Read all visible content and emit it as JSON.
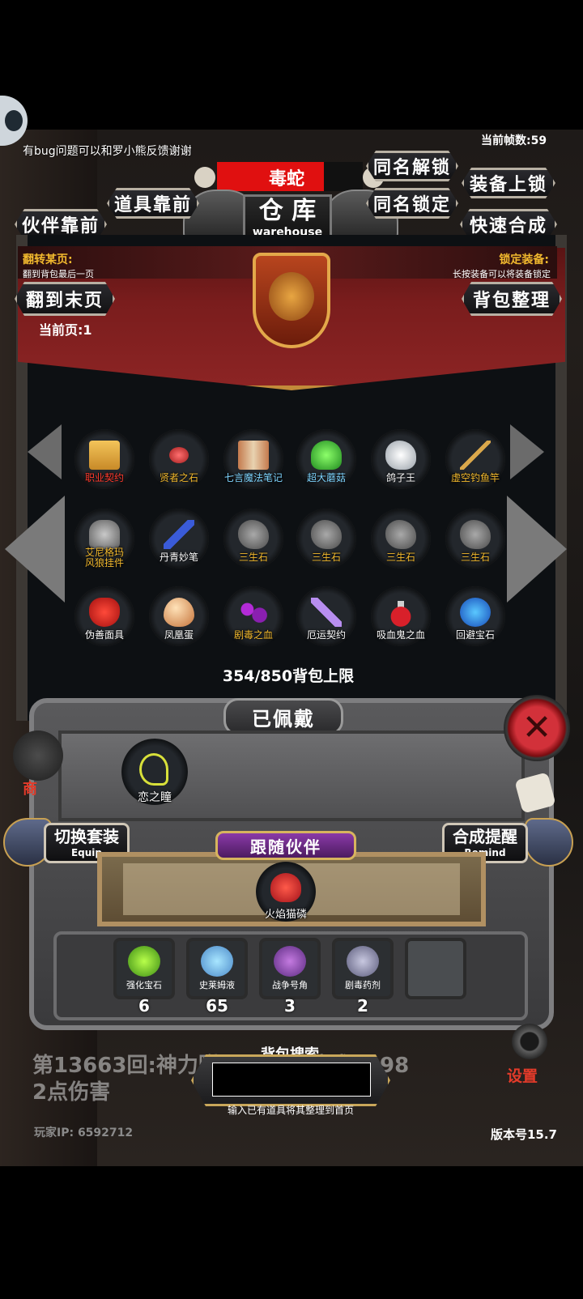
{
  "hud": {
    "feedback_text": "有bug问题可以和罗小熊反馈谢谢",
    "fps_text": "当前帧数:59",
    "companion_name": "毒蛇",
    "title_cn": "仓 库",
    "title_en": "warehouse"
  },
  "buttons": {
    "unlock_same_name": "同名解锁",
    "lock_equipment": "装备上锁",
    "items_first": "道具靠前",
    "lock_same_name": "同名锁定",
    "partner_first": "伙伴靠前",
    "quick_synthesis": "快速合成",
    "flip_to_last": "翻到末页",
    "sort_bag": "背包整理"
  },
  "info": {
    "flip_page_title": "翻转某页:",
    "flip_page_desc": "翻到背包最后一页",
    "lock_equip_title": "锁定装备:",
    "lock_equip_desc": "长按装备可以将装备锁定",
    "current_page": "当前页:1"
  },
  "inventory": {
    "items": [
      {
        "name": "职业契约",
        "color": "red",
        "icon": "scroll-icon"
      },
      {
        "name": "贤者之石",
        "color": "yellow",
        "icon": "red-stone-icon"
      },
      {
        "name": "七言魔法笔记",
        "color": "cyan",
        "icon": "book-icon"
      },
      {
        "name": "超大蘑菇",
        "color": "cyan",
        "icon": "green-mushroom-icon"
      },
      {
        "name": "鸽子王",
        "color": "white",
        "icon": "dove-icon"
      },
      {
        "name": "虚空钓鱼竿",
        "color": "yellow",
        "icon": "fishing-rod-icon"
      },
      {
        "name": "艾尼格玛\n风狼挂件",
        "color": "yellow",
        "icon": "wolf-pendant-icon"
      },
      {
        "name": "丹青妙笔",
        "color": "white",
        "icon": "brush-icon"
      },
      {
        "name": "三生石",
        "color": "yellow",
        "icon": "stone-icon"
      },
      {
        "name": "三生石",
        "color": "yellow",
        "icon": "stone-icon"
      },
      {
        "name": "三生石",
        "color": "yellow",
        "icon": "stone-icon"
      },
      {
        "name": "三生石",
        "color": "yellow",
        "icon": "stone-icon"
      },
      {
        "name": "伪善面具",
        "color": "white",
        "icon": "mask-icon"
      },
      {
        "name": "凤凰蛋",
        "color": "white",
        "icon": "egg-icon"
      },
      {
        "name": "剧毒之血",
        "color": "yellow",
        "icon": "poison-blood-icon"
      },
      {
        "name": "厄运契约",
        "color": "white",
        "icon": "contract-icon"
      },
      {
        "name": "吸血鬼之血",
        "color": "white",
        "icon": "potion-icon"
      },
      {
        "name": "回避宝石",
        "color": "white",
        "icon": "blue-gem-icon"
      }
    ],
    "capacity_text": "354/850背包上限"
  },
  "equipped": {
    "title": "已佩戴",
    "item_name": "恋之瞳",
    "switch_set_cn": "切换套装",
    "switch_set_en": "Equip",
    "synth_remind_cn": "合成提醒",
    "synth_remind_en": "Remind",
    "follow_partner": "跟随伙伴",
    "partner_name": "火焰猫磷"
  },
  "consumables": [
    {
      "name": "强化宝石",
      "count": "6",
      "icon": "green-crystal-icon"
    },
    {
      "name": "史莱姆液",
      "count": "65",
      "icon": "slime-bottle-icon"
    },
    {
      "name": "战争号角",
      "count": "3",
      "icon": "horn-icon"
    },
    {
      "name": "剧毒药剂",
      "count": "2",
      "icon": "poison-potion-icon"
    }
  ],
  "bottom": {
    "log_line1": "第13663回:神力附",
    "log_line1_tail": "造成6098",
    "log_line2": "2点伤害",
    "search_title": "背包搜索",
    "search_value": "",
    "search_hint": "输入已有道具将其整理到首页",
    "player_ip": "玩家IP:  6592712",
    "version": "版本号15.7",
    "settings": "设置",
    "shop_partial": "商"
  },
  "colors": {
    "red": "#ff3b2e",
    "yellow": "#f2b92e",
    "cyan": "#7fd5ff",
    "white": "#ffffff"
  }
}
